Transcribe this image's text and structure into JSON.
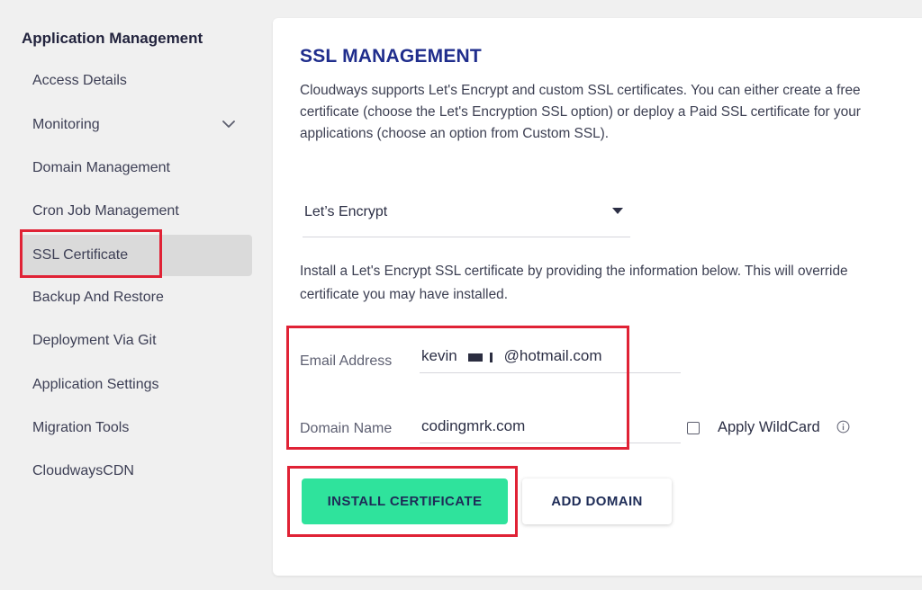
{
  "sidebar": {
    "title": "Application Management",
    "items": [
      {
        "label": "Access Details"
      },
      {
        "label": "Monitoring"
      },
      {
        "label": "Domain Management"
      },
      {
        "label": "Cron Job Management"
      },
      {
        "label": "SSL Certificate"
      },
      {
        "label": "Backup And Restore"
      },
      {
        "label": "Deployment Via Git"
      },
      {
        "label": "Application Settings"
      },
      {
        "label": "Migration Tools"
      },
      {
        "label": "CloudwaysCDN"
      }
    ],
    "active_item": "SSL Certificate",
    "icons": {
      "monitoring_expand": "chevron-down-icon"
    }
  },
  "main": {
    "title": "SSL MANAGEMENT",
    "description_lines": [
      "Cloudways supports Let's Encrypt and custom SSL certificates. You can either create a free",
      "certificate (choose the Let's Encryption SSL option) or deploy a Paid SSL certificate for your",
      "applications (choose an option from Custom SSL)."
    ],
    "ssl_type": {
      "selected": "Let’s Encrypt",
      "icon": "caret-down-icon"
    },
    "info_lines": [
      "Install a Let's Encrypt SSL certificate by providing the information below. This will override",
      "certificate you may have installed."
    ],
    "email": {
      "label": "Email Address",
      "value": "kevin           @hotmail.com"
    },
    "domain": {
      "label": "Domain Name",
      "value": "codingmrk.com"
    },
    "wildcard": {
      "label": "Apply WildCard",
      "checked": false,
      "icon": "info-icon"
    },
    "buttons": {
      "install": "INSTALL CERTIFICATE",
      "add_domain": "ADD DOMAIN"
    }
  },
  "colors": {
    "accent_green": "#2fe39c",
    "title_blue": "#1f2d8c",
    "highlight_red": "#e02235",
    "active_item_bg": "#dadada"
  }
}
